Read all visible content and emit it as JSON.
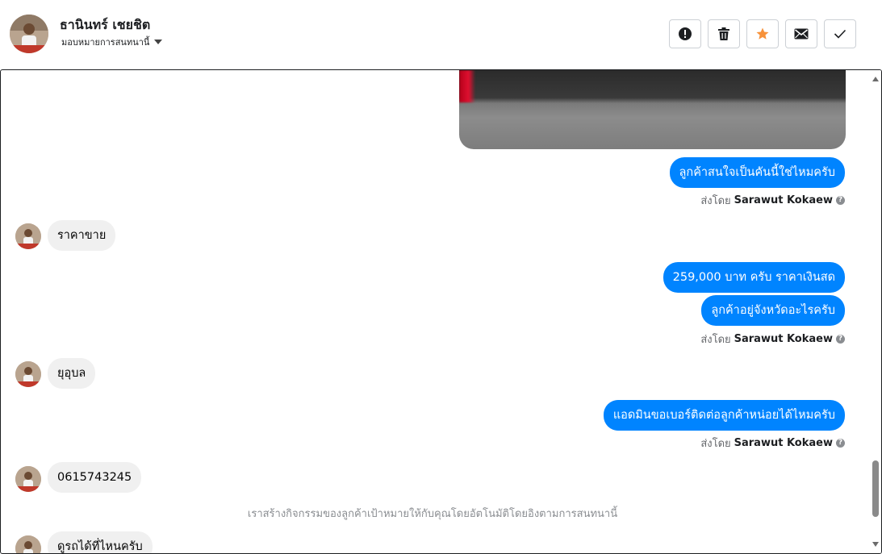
{
  "header": {
    "contact_name": "ธานินทร์ เชยชิต",
    "assign_label": "มอบหมายการสนทนานี้",
    "toolbar": [
      "alert-icon",
      "trash-icon",
      "star-icon",
      "mail-icon",
      "check-icon"
    ],
    "star_color": "#f7923a"
  },
  "conversation": {
    "bubble_color": "#0084ff",
    "messages": [
      {
        "id": "m1",
        "text": "ลูกค้าสนใจเป็นคันนี้ใช่ไหมครับ"
      },
      {
        "id": "m2",
        "text": "ราคาขาย"
      },
      {
        "id": "m3",
        "text": "259,000 บาท ครับ ราคาเงินสด"
      },
      {
        "id": "m4",
        "text": "ลูกค้าอยู่จังหวัดอะไรครับ"
      },
      {
        "id": "m5",
        "text": "ยุอุบล"
      },
      {
        "id": "m6",
        "text": "แอดมินขอเบอร์ติดต่อลูกค้าหน่อยได้ไหมครับ"
      },
      {
        "id": "m7",
        "text": "0615743245"
      },
      {
        "id": "m8",
        "text": "ดูรถได้ที่ไหนครับ"
      }
    ],
    "sent_by_prefix": "ส่งโดย",
    "sent_by_name": "Sarawut Kokaew",
    "system_note": "เราสร้างกิจกรรมของลูกค้าเป้าหมายให้กับคุณโดยอัตโนมัติโดยอิงตามการสนทนานี้"
  }
}
